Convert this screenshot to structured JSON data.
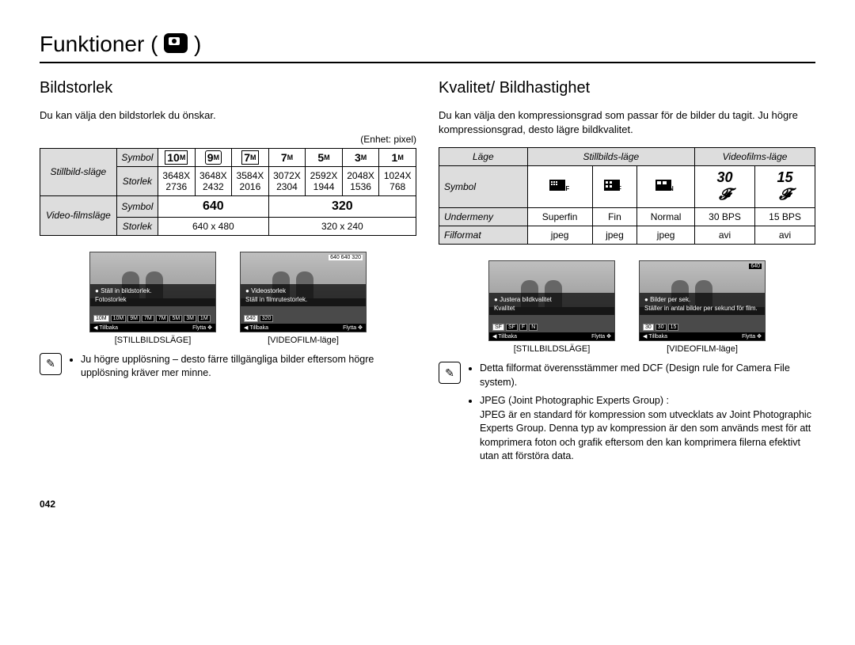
{
  "title_prefix": "Funktioner (",
  "title_suffix": " )",
  "fn_icon_label": "Fn",
  "left": {
    "heading": "Bildstorlek",
    "desc": "Du kan välja den bildstorlek du önskar.",
    "unit": "(Enhet: pixel)",
    "row_group_still": "Stillbild-släge",
    "row_group_video": "Video-filmsläge",
    "label_symbol": "Symbol",
    "label_size": "Storlek",
    "still_symbols": [
      "10",
      "9",
      "7",
      "7",
      "5",
      "3",
      "1"
    ],
    "still_symbol_suffix": "M",
    "still_sizes_top": [
      "3648X",
      "3648X",
      "3584X",
      "3072X",
      "2592X",
      "2048X",
      "1024X"
    ],
    "still_sizes_bot": [
      "2736",
      "2432",
      "2016",
      "2304",
      "1944",
      "1536",
      "768"
    ],
    "video_symbols": [
      "640",
      "320"
    ],
    "video_sizes": [
      "640 x 480",
      "320 x 240"
    ],
    "preview1": {
      "line1": "Ställ in bildstorlek.",
      "line2": "Fotostorlek",
      "hint": "",
      "footer_left": "Tillbaka",
      "footer_right": "Flytta",
      "caption": "[STILLBILDSLÄGE]"
    },
    "preview2": {
      "line1": "Videostorlek",
      "line2": "Ställ in filmrutestorlek.",
      "hint": "640  640  320",
      "footer_left": "Tillbaka",
      "footer_right": "Flytta",
      "caption": "[VIDEOFILM-läge]"
    },
    "note": "Ju högre upplösning – desto färre tillgängliga bilder eftersom högre upplösning kräver mer minne."
  },
  "right": {
    "heading": "Kvalitet/ Bildhastighet",
    "desc": "Du kan välja den kompressionsgrad som passar för de bilder du tagit. Ju högre kompressionsgrad, desto lägre bildkvalitet.",
    "headers": {
      "mode": "Läge",
      "still": "Stillbilds-läge",
      "video": "Videofilms-läge"
    },
    "row_labels": {
      "symbol": "Symbol",
      "submenu": "Undermeny",
      "format": "Filformat"
    },
    "symbol_labels": [
      "SF",
      "F",
      "N",
      "30",
      "15"
    ],
    "submenu": [
      "Superfin",
      "Fin",
      "Normal",
      "30 BPS",
      "15 BPS"
    ],
    "format": [
      "jpeg",
      "jpeg",
      "jpeg",
      "avi",
      "avi"
    ],
    "preview1": {
      "line1": "Justera bildkvalitet",
      "line2": "Kvalitet",
      "footer_left": "Tillbaka",
      "footer_right": "Flytta",
      "caption": "[STILLBILDSLÄGE]"
    },
    "preview2": {
      "topright": "640",
      "line1": "Bilder per sek.",
      "line2": "Ställer in antal bilder per sekund för film.",
      "footer_left": "Tillbaka",
      "footer_right": "Flytta",
      "caption": "[VIDEOFILM-läge]"
    },
    "notes": [
      "Detta filformat överensstämmer med DCF (Design rule for Camera File system).",
      "JPEG (Joint Photographic Experts Group)  :"
    ],
    "jpeg_detail": "JPEG är en standard för kompression som utvecklats av Joint Photographic Experts Group. Denna typ av kompression är den som används mest för att komprimera foton och grafik eftersom den kan komprimera filerna efektivt utan att förstöra data."
  },
  "page_number": "042"
}
